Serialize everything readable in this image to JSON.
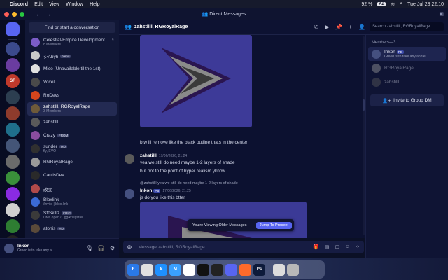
{
  "menubar": {
    "app": "Discord",
    "items": [
      "Edit",
      "View",
      "Window",
      "Help"
    ],
    "battery": "92 %",
    "input_badge": "AZ",
    "datetime": "Tue Jul 28  22:10"
  },
  "window": {
    "title": "Direct Messages"
  },
  "servers": [
    {
      "label": "",
      "color": "#5865f2"
    },
    {
      "label": "",
      "color": "#3b4a8c"
    },
    {
      "label": "",
      "color": "#6a3ca0"
    },
    {
      "label": "SF",
      "color": "#c0392b"
    },
    {
      "label": "",
      "color": "#2c3e50"
    },
    {
      "label": "",
      "color": "#8e3b2c"
    },
    {
      "label": "",
      "color": "#1f6f8b"
    },
    {
      "label": "",
      "color": "#445577"
    },
    {
      "label": "",
      "color": "#6b6b6b"
    },
    {
      "label": "",
      "color": "#3a8f3a"
    },
    {
      "label": "",
      "color": "#8a2be2"
    },
    {
      "label": "",
      "color": "#d0d0d0"
    },
    {
      "label": "",
      "color": "#2e7d32"
    },
    {
      "label": "",
      "color": "#222222"
    },
    {
      "label": "",
      "color": "#556080"
    },
    {
      "label": "",
      "color": "#33556e"
    }
  ],
  "dm_list": {
    "search_label": "Find or start a conversation",
    "items": [
      {
        "name": "Celestial-Empire Development",
        "sub": "8 Members",
        "tag": "",
        "color": "#7b5cc7",
        "active": false
      },
      {
        "name": "シAbyh",
        "sub": "",
        "tag": "blend",
        "color": "#c8c8c8",
        "active": false
      },
      {
        "name": "Mico (Unavailable til the 1st)",
        "sub": "",
        "tag": "",
        "color": "#e0e0e0",
        "active": false
      },
      {
        "name": "Voxel",
        "sub": "",
        "tag": "",
        "color": "#4a4a4a",
        "active": false
      },
      {
        "name": "RoDevs",
        "sub": "",
        "tag": "",
        "color": "#d4451d",
        "active": false
      },
      {
        "name": "zahstilll, RGRoyalRage",
        "sub": "3 Members",
        "tag": "",
        "color": "#6e5a3a",
        "active": true
      },
      {
        "name": "zahstilll",
        "sub": "",
        "tag": "",
        "color": "#5a5a5a",
        "active": false
      },
      {
        "name": "Crazy",
        "sub": "",
        "tag": "FROM",
        "color": "#8a4d9f",
        "active": false
      },
      {
        "name": "sunder",
        "sub": "fly, EVO",
        "tag": "MD",
        "color": "#303030",
        "active": false
      },
      {
        "name": "RGRoyalRage",
        "sub": "",
        "tag": "",
        "color": "#9a9a9a",
        "active": false
      },
      {
        "name": "CaulisDev",
        "sub": "",
        "tag": "",
        "color": "#2a2a2a",
        "active": false
      },
      {
        "name": "改变",
        "sub": "",
        "tag": "",
        "color": "#b04a4a",
        "active": false
      },
      {
        "name": "Bloxlink",
        "sub": "/invite | blox.link",
        "tag": "",
        "color": "#3b6bd6",
        "active": false
      },
      {
        "name": "SftSkillz",
        "sub": "DMs open // .gg/kriegsfall",
        "tag": "KRIG",
        "color": "#3a3a3a",
        "active": false
      },
      {
        "name": "atonis",
        "sub": "",
        "tag": "HD",
        "color": "#5a4a3a",
        "active": false
      }
    ]
  },
  "user": {
    "name": "Inkon",
    "status": "Greed is to take any a..."
  },
  "chat_header": {
    "title": "zahstilll, RGRoyalRage",
    "search_placeholder": "Search zahstilll, RGRoyalRage"
  },
  "messages": {
    "m1_text": "btw lll remove like the black outline thats in the center",
    "m2_author": "zahstilll",
    "m2_time": "17/06/2026, 21:24",
    "m2_line1": "yea we still do need maybe 1-2 layers of shade",
    "m2_line2": "but not to the point of hyper realism yknow",
    "m3_reply": "@zahstilll  yea we still do need maybe 1-2 layers of shade",
    "m3_author": "Inkon",
    "m3_tag": "PB",
    "m3_time": "17/06/2026, 21:25",
    "m3_text": "js do you like this btter"
  },
  "older_bar": {
    "text": "You're Viewing Older Messages",
    "button": "Jump To Present"
  },
  "composer": {
    "placeholder": "Message zahstilll, RGRoyalRage"
  },
  "members": {
    "title": "Members—3",
    "items": [
      {
        "name": "Inkon",
        "tag": "PB",
        "status": "Greed is to take any and e...",
        "color": "#45507f",
        "active": true,
        "dim": false
      },
      {
        "name": "RGRoyalRage",
        "tag": "",
        "status": "",
        "color": "#9a9a9a",
        "active": false,
        "dim": true
      },
      {
        "name": "zahstilll",
        "tag": "",
        "status": "",
        "color": "#5a5a5a",
        "active": false,
        "dim": true
      }
    ],
    "invite_label": "Invite to Group DM"
  },
  "dock": [
    {
      "label": "F",
      "color": "#2a79e8"
    },
    {
      "label": "",
      "color": "#e0e0e0"
    },
    {
      "label": "S",
      "color": "#1e90ff"
    },
    {
      "label": "M",
      "color": "#3aa0ff"
    },
    {
      "label": "",
      "color": "#ffffff"
    },
    {
      "label": "",
      "color": "#111111"
    },
    {
      "label": "",
      "color": "#222222"
    },
    {
      "label": "",
      "color": "#5865f2"
    },
    {
      "label": "",
      "color": "#ff6a2a"
    },
    {
      "label": "Ps",
      "color": "#0d1a3a"
    },
    {
      "label": "",
      "color": "#dcdcdc"
    },
    {
      "label": "",
      "color": "#b8b8b8"
    }
  ]
}
